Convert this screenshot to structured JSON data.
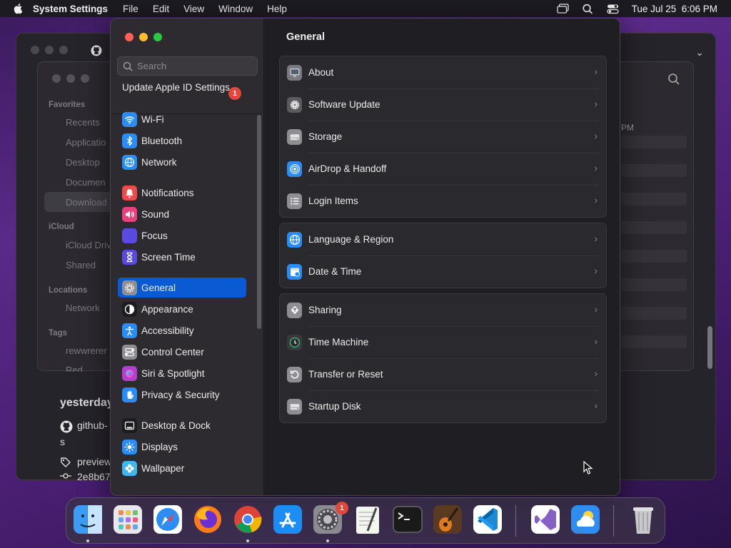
{
  "menubar": {
    "app_name": "System Settings",
    "menus": [
      "File",
      "Edit",
      "View",
      "Window",
      "Help"
    ],
    "clock": "Tue Jul 25  6:06 PM"
  },
  "background": {
    "finder_sidebar": {
      "favorites_header": "Favorites",
      "favorites": [
        "Recents",
        "Applicatio",
        "Desktop",
        "Documen",
        "Download"
      ],
      "icloud_header": "iCloud",
      "icloud": [
        "iCloud Driv",
        "Shared"
      ],
      "locations_header": "Locations",
      "locations": [
        "Network"
      ],
      "tags_header": "Tags",
      "tags": [
        "rewwrerer",
        "Red"
      ]
    },
    "time_partial": "PM",
    "bottom_texts": [
      "yesterday",
      "github-",
      "s",
      "preview",
      "2e8b67"
    ]
  },
  "settings": {
    "search_placeholder": "Search",
    "apple_id_label": "Update Apple ID Settings",
    "apple_id_badge": "1",
    "sidebar": [
      {
        "label": "Wi-Fi",
        "icon": "wifi-icon",
        "color": "#2a8cf7"
      },
      {
        "label": "Bluetooth",
        "icon": "bluetooth-icon",
        "color": "#2a8cf7"
      },
      {
        "label": "Network",
        "icon": "globe-icon",
        "color": "#2a8cf7"
      },
      {
        "label": "Notifications",
        "icon": "bell-icon",
        "color": "#ef4b4b"
      },
      {
        "label": "Sound",
        "icon": "speaker-icon",
        "color": "#e8407f"
      },
      {
        "label": "Focus",
        "icon": "moon-icon",
        "color": "#5a4ae2"
      },
      {
        "label": "Screen Time",
        "icon": "hourglass-icon",
        "color": "#5a4ae2"
      },
      {
        "label": "General",
        "icon": "gear-icon",
        "color": "#8e8e93",
        "selected": true
      },
      {
        "label": "Appearance",
        "icon": "appearance-icon",
        "color": "#1c1c1e"
      },
      {
        "label": "Accessibility",
        "icon": "accessibility-icon",
        "color": "#2a8cf7"
      },
      {
        "label": "Control Center",
        "icon": "switches-icon",
        "color": "#8e8e93"
      },
      {
        "label": "Siri & Spotlight",
        "icon": "siri-icon",
        "color": "#b23fd0"
      },
      {
        "label": "Privacy & Security",
        "icon": "hand-icon",
        "color": "#2a8cf7"
      },
      {
        "label": "Desktop & Dock",
        "icon": "dock-icon",
        "color": "#1c1c1e"
      },
      {
        "label": "Displays",
        "icon": "sun-icon",
        "color": "#2a8cf7"
      },
      {
        "label": "Wallpaper",
        "icon": "flower-icon",
        "color": "#3fb7e8"
      }
    ],
    "main_title": "General",
    "groups": [
      [
        {
          "label": "About",
          "icon": "computer-icon"
        },
        {
          "label": "Software Update",
          "icon": "gear-badge-icon"
        },
        {
          "label": "Storage",
          "icon": "disk-icon"
        },
        {
          "label": "AirDrop & Handoff",
          "icon": "airdrop-icon"
        },
        {
          "label": "Login Items",
          "icon": "list-icon"
        }
      ],
      [
        {
          "label": "Language & Region",
          "icon": "globe-icon"
        },
        {
          "label": "Date & Time",
          "icon": "calendar-icon"
        }
      ],
      [
        {
          "label": "Sharing",
          "icon": "sharing-icon"
        },
        {
          "label": "Time Machine",
          "icon": "time-machine-icon"
        },
        {
          "label": "Transfer or Reset",
          "icon": "reset-icon"
        },
        {
          "label": "Startup Disk",
          "icon": "disk-icon"
        }
      ]
    ]
  },
  "dock": {
    "apps": [
      "Finder",
      "Launchpad",
      "Safari",
      "Firefox",
      "Chrome",
      "App Store",
      "System Settings",
      "TextEdit",
      "Terminal",
      "GarageBand",
      "VS Code",
      "Visual Studio",
      "Weather",
      "Trash"
    ],
    "settings_badge": "1"
  }
}
